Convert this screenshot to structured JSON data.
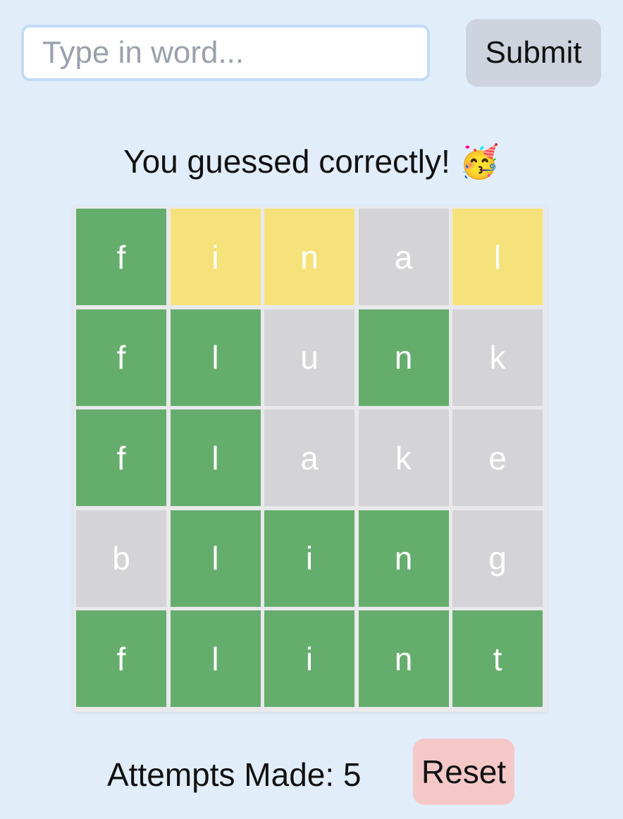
{
  "input": {
    "placeholder": "Type in word...",
    "value": ""
  },
  "submit_label": "Submit",
  "message": "You guessed correctly! 🥳",
  "board": {
    "rows": [
      [
        {
          "letter": "f",
          "state": "correct"
        },
        {
          "letter": "i",
          "state": "present"
        },
        {
          "letter": "n",
          "state": "present"
        },
        {
          "letter": "a",
          "state": "absent"
        },
        {
          "letter": "l",
          "state": "present"
        }
      ],
      [
        {
          "letter": "f",
          "state": "correct"
        },
        {
          "letter": "l",
          "state": "correct"
        },
        {
          "letter": "u",
          "state": "absent"
        },
        {
          "letter": "n",
          "state": "correct"
        },
        {
          "letter": "k",
          "state": "absent"
        }
      ],
      [
        {
          "letter": "f",
          "state": "correct"
        },
        {
          "letter": "l",
          "state": "correct"
        },
        {
          "letter": "a",
          "state": "absent"
        },
        {
          "letter": "k",
          "state": "absent"
        },
        {
          "letter": "e",
          "state": "absent"
        }
      ],
      [
        {
          "letter": "b",
          "state": "absent"
        },
        {
          "letter": "l",
          "state": "correct"
        },
        {
          "letter": "i",
          "state": "correct"
        },
        {
          "letter": "n",
          "state": "correct"
        },
        {
          "letter": "g",
          "state": "absent"
        }
      ],
      [
        {
          "letter": "f",
          "state": "correct"
        },
        {
          "letter": "l",
          "state": "correct"
        },
        {
          "letter": "i",
          "state": "correct"
        },
        {
          "letter": "n",
          "state": "correct"
        },
        {
          "letter": "t",
          "state": "correct"
        }
      ]
    ]
  },
  "colors": {
    "correct": "#65ad6d",
    "present": "#f6e27b",
    "absent": "#d4d4d8",
    "background": "#e1eefa",
    "submit_bg": "#cdd4de",
    "reset_bg": "#f5c8c8"
  },
  "attempts_text": "Attempts Made: 5",
  "reset_label": "Reset"
}
